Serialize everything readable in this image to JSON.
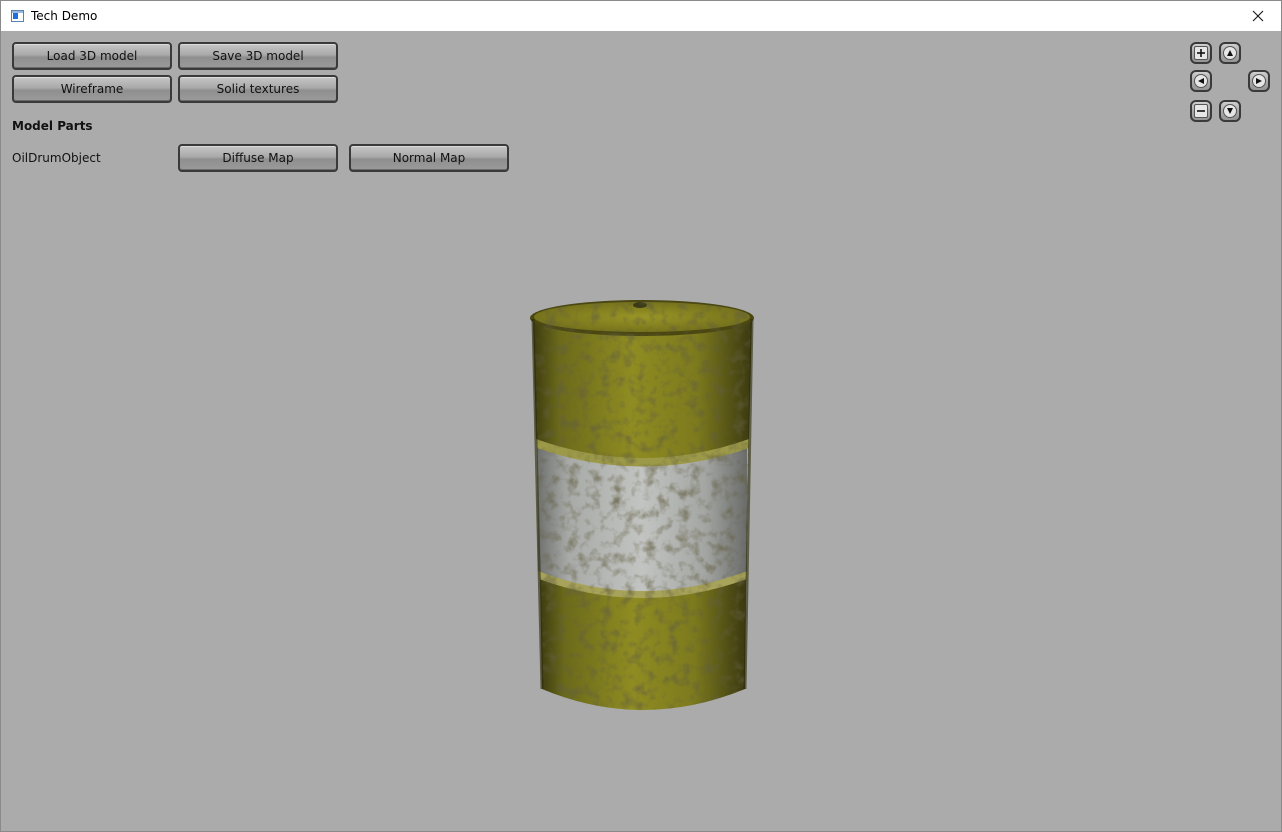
{
  "window": {
    "title": "Tech Demo"
  },
  "toolbar": {
    "load_model": "Load 3D model",
    "save_model": "Save 3D model",
    "wireframe": "Wireframe",
    "solid_textures": "Solid textures"
  },
  "model_parts": {
    "heading": "Model Parts",
    "parts": [
      {
        "name": "OilDrumObject",
        "diffuse_label": "Diffuse Map",
        "normal_label": "Normal Map"
      }
    ]
  },
  "navigation": {
    "zoom_in": "plus-icon",
    "zoom_out": "minus-icon",
    "up": "arrow-up-icon",
    "down": "arrow-down-icon",
    "left": "arrow-left-icon",
    "right": "arrow-right-icon"
  },
  "scene": {
    "object": "oil-drum",
    "colors": {
      "background": "#ababab",
      "drum_yellow": "#8c8a1e",
      "drum_band": "#b4b6b4"
    }
  }
}
